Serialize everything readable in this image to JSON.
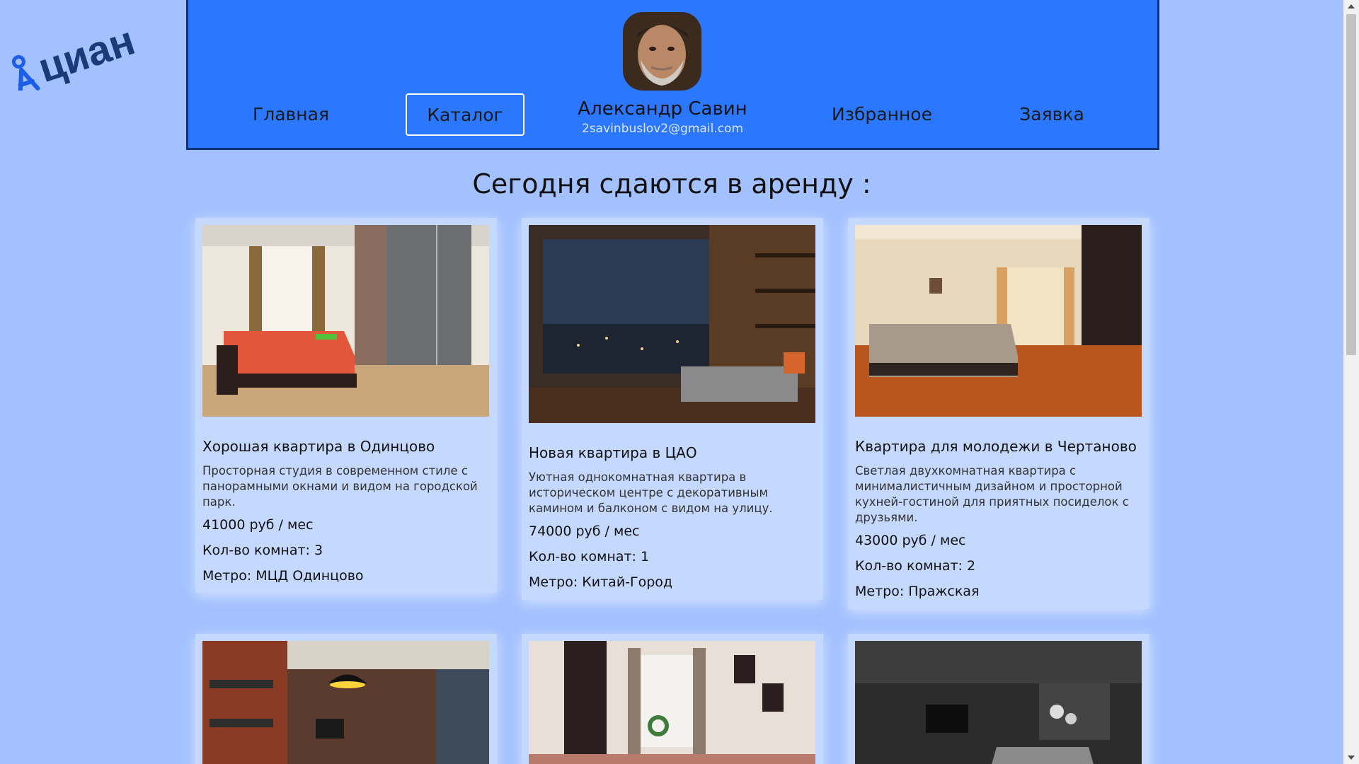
{
  "logo": {
    "text": "циан",
    "icon": "map-pin-person-icon"
  },
  "header": {
    "nav": {
      "home": "Главная",
      "catalog": "Каталог",
      "favorites": "Избранное",
      "order": "Заявка"
    },
    "user": {
      "name": "Александр Савин",
      "email": "2savinbuslov2@gmail.com",
      "avatar": "avatar-photo"
    }
  },
  "main": {
    "title": "Сегодня сдаются в аренду :",
    "cards": [
      {
        "title": "Хорошая квартира в Одинцово",
        "description": "Просторная студия в современном стиле с панорамными окнами и видом на городской парк.",
        "price": "41000 руб / мес",
        "rooms": "Кол-во комнат: 3",
        "metro": "Метро: МЦД Одинцово"
      },
      {
        "title": "Новая квартира в ЦАО",
        "description": "Уютная однокомнатная квартира в историческом центре с декоративным камином и балконом с видом на улицу.",
        "price": "74000 руб / мес",
        "rooms": "Кол-во комнат: 1",
        "metro": "Метро: Китай-Город"
      },
      {
        "title": "Квартира для молодежи в Чертаново",
        "description": "Светлая двухкомнатная квартира с минималистичным дизайном и просторной кухней-гостиной для приятных посиделок с друзьями.",
        "price": "43000 руб / мес",
        "rooms": "Кол-во комнат: 2",
        "metro": "Метро: Пражская"
      }
    ]
  },
  "colors": {
    "page_bg": "#a3c1ff",
    "header_bg": "#2b78ff",
    "card_bg": "#c5d9ff",
    "logo": "#1d5ee8"
  }
}
